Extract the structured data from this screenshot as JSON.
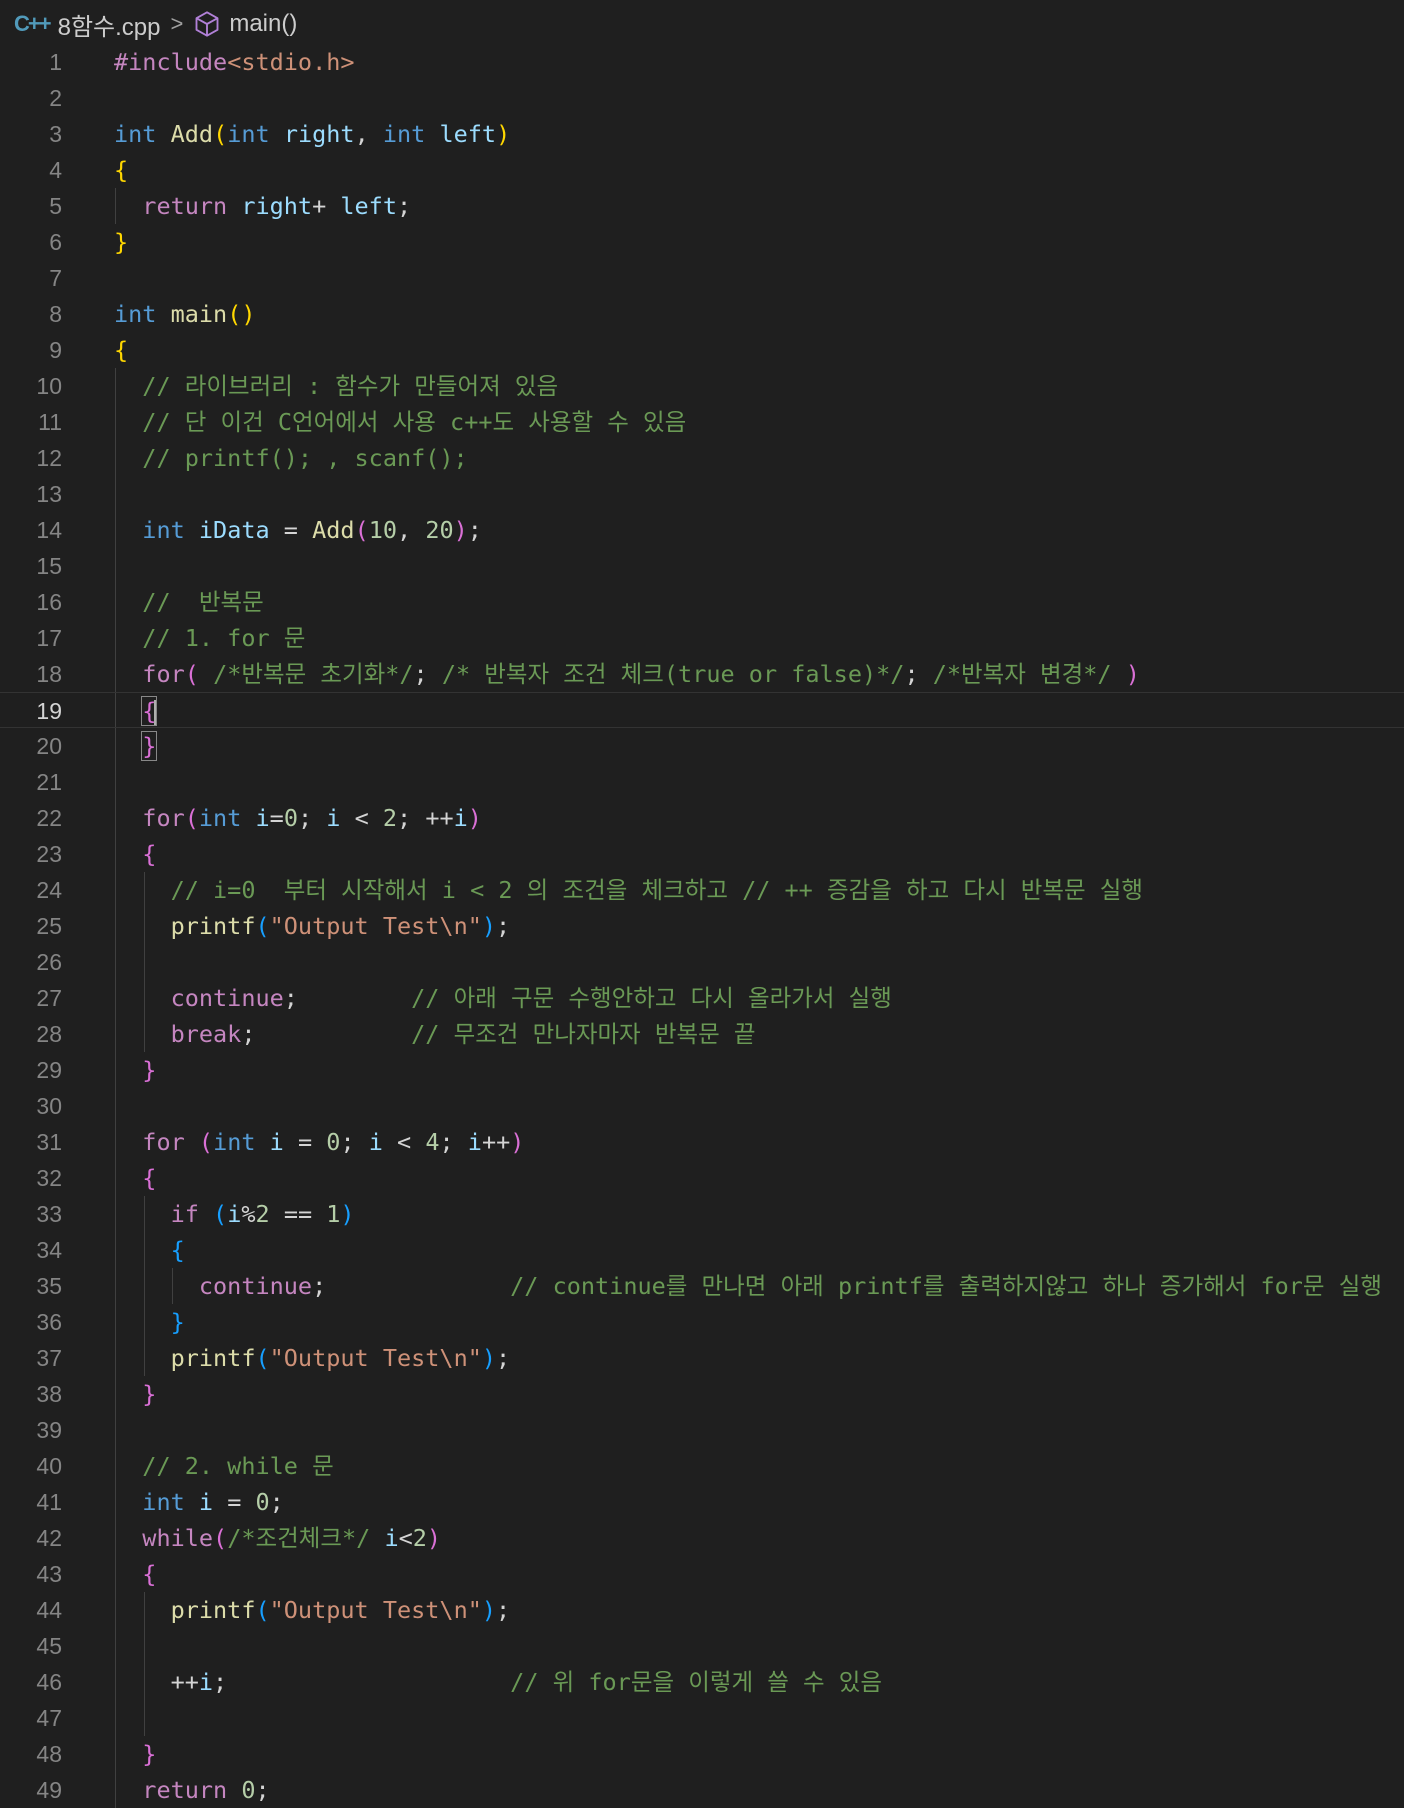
{
  "breadcrumb": {
    "file_icon": "C++",
    "file": "8함수.cpp",
    "symbol": "main()"
  },
  "active_line": 19,
  "lines": [
    {
      "n": "1",
      "t": [
        [
          "pp",
          "#include"
        ],
        [
          "inc",
          "<stdio.h>"
        ]
      ]
    },
    {
      "n": "2",
      "t": []
    },
    {
      "n": "3",
      "t": [
        [
          "kw",
          "int"
        ],
        [
          "txt",
          " "
        ],
        [
          "fn",
          "Add"
        ],
        [
          "b1",
          "("
        ],
        [
          "kw",
          "int"
        ],
        [
          "txt",
          " "
        ],
        [
          "var",
          "right"
        ],
        [
          "txt",
          ", "
        ],
        [
          "kw",
          "int"
        ],
        [
          "txt",
          " "
        ],
        [
          "var",
          "left"
        ],
        [
          "b1",
          ")"
        ]
      ]
    },
    {
      "n": "4",
      "t": [
        [
          "b1",
          "{"
        ]
      ]
    },
    {
      "n": "5",
      "t": [
        [
          "txt",
          "  "
        ],
        [
          "ctl",
          "return"
        ],
        [
          "txt",
          " "
        ],
        [
          "var",
          "right"
        ],
        [
          "txt",
          "+ "
        ],
        [
          "var",
          "left"
        ],
        [
          "txt",
          ";"
        ]
      ]
    },
    {
      "n": "6",
      "t": [
        [
          "b1",
          "}"
        ]
      ]
    },
    {
      "n": "7",
      "t": []
    },
    {
      "n": "8",
      "t": [
        [
          "kw",
          "int"
        ],
        [
          "txt",
          " "
        ],
        [
          "fn",
          "main"
        ],
        [
          "b1",
          "()"
        ]
      ]
    },
    {
      "n": "9",
      "t": [
        [
          "b1",
          "{"
        ]
      ]
    },
    {
      "n": "10",
      "t": [
        [
          "txt",
          "  "
        ],
        [
          "cmt",
          "// 라이브러리 : 함수가 만들어져 있음"
        ]
      ]
    },
    {
      "n": "11",
      "t": [
        [
          "txt",
          "  "
        ],
        [
          "cmt",
          "// 단 이건 C언어에서 사용 c++도 사용할 수 있음"
        ]
      ]
    },
    {
      "n": "12",
      "t": [
        [
          "txt",
          "  "
        ],
        [
          "cmt",
          "// printf(); , scanf();"
        ]
      ]
    },
    {
      "n": "13",
      "t": []
    },
    {
      "n": "14",
      "t": [
        [
          "txt",
          "  "
        ],
        [
          "kw",
          "int"
        ],
        [
          "txt",
          " "
        ],
        [
          "var",
          "iData"
        ],
        [
          "txt",
          " = "
        ],
        [
          "fn",
          "Add"
        ],
        [
          "b2",
          "("
        ],
        [
          "num",
          "10"
        ],
        [
          "txt",
          ", "
        ],
        [
          "num",
          "20"
        ],
        [
          "b2",
          ")"
        ],
        [
          "txt",
          ";"
        ]
      ]
    },
    {
      "n": "15",
      "t": []
    },
    {
      "n": "16",
      "t": [
        [
          "txt",
          "  "
        ],
        [
          "cmt",
          "//  반복문"
        ]
      ]
    },
    {
      "n": "17",
      "t": [
        [
          "txt",
          "  "
        ],
        [
          "cmt",
          "// 1. for 문"
        ]
      ]
    },
    {
      "n": "18",
      "t": [
        [
          "txt",
          "  "
        ],
        [
          "ctl",
          "for"
        ],
        [
          "b2",
          "("
        ],
        [
          "txt",
          " "
        ],
        [
          "cmt",
          "/*반복문 초기화*/"
        ],
        [
          "txt",
          "; "
        ],
        [
          "cmt",
          "/* 반복자 조건 체크(true or false)*/"
        ],
        [
          "txt",
          "; "
        ],
        [
          "cmt",
          "/*반복자 변경*/"
        ],
        [
          "txt",
          " "
        ],
        [
          "b2",
          ")"
        ]
      ]
    },
    {
      "n": "19",
      "t": [
        [
          "txt",
          "  "
        ],
        [
          "bx",
          "{"
        ]
      ]
    },
    {
      "n": "20",
      "t": [
        [
          "txt",
          "  "
        ],
        [
          "bx",
          "}"
        ]
      ]
    },
    {
      "n": "21",
      "t": []
    },
    {
      "n": "22",
      "t": [
        [
          "txt",
          "  "
        ],
        [
          "ctl",
          "for"
        ],
        [
          "b2",
          "("
        ],
        [
          "kw",
          "int"
        ],
        [
          "txt",
          " "
        ],
        [
          "var",
          "i"
        ],
        [
          "txt",
          "="
        ],
        [
          "num",
          "0"
        ],
        [
          "txt",
          "; "
        ],
        [
          "var",
          "i"
        ],
        [
          "txt",
          " < "
        ],
        [
          "num",
          "2"
        ],
        [
          "txt",
          "; ++"
        ],
        [
          "var",
          "i"
        ],
        [
          "b2",
          ")"
        ]
      ]
    },
    {
      "n": "23",
      "t": [
        [
          "txt",
          "  "
        ],
        [
          "b2",
          "{"
        ]
      ]
    },
    {
      "n": "24",
      "t": [
        [
          "txt",
          "    "
        ],
        [
          "cmt",
          "// i=0  부터 시작해서 i < 2 의 조건을 체크하고 // ++ 증감을 하고 다시 반복문 실행"
        ]
      ]
    },
    {
      "n": "25",
      "t": [
        [
          "txt",
          "    "
        ],
        [
          "fn",
          "printf"
        ],
        [
          "b3",
          "("
        ],
        [
          "str",
          "\"Output Test\\n\""
        ],
        [
          "b3",
          ")"
        ],
        [
          "txt",
          ";"
        ]
      ]
    },
    {
      "n": "26",
      "t": []
    },
    {
      "n": "27",
      "t": [
        [
          "txt",
          "    "
        ],
        [
          "ctl",
          "continue"
        ],
        [
          "txt",
          ";        "
        ],
        [
          "cmt",
          "// 아래 구문 수행안하고 다시 올라가서 실행"
        ]
      ]
    },
    {
      "n": "28",
      "t": [
        [
          "txt",
          "    "
        ],
        [
          "ctl",
          "break"
        ],
        [
          "txt",
          ";           "
        ],
        [
          "cmt",
          "// 무조건 만나자마자 반복문 끝"
        ]
      ]
    },
    {
      "n": "29",
      "t": [
        [
          "txt",
          "  "
        ],
        [
          "b2",
          "}"
        ]
      ]
    },
    {
      "n": "30",
      "t": []
    },
    {
      "n": "31",
      "t": [
        [
          "txt",
          "  "
        ],
        [
          "ctl",
          "for"
        ],
        [
          "txt",
          " "
        ],
        [
          "b2",
          "("
        ],
        [
          "kw",
          "int"
        ],
        [
          "txt",
          " "
        ],
        [
          "var",
          "i"
        ],
        [
          "txt",
          " = "
        ],
        [
          "num",
          "0"
        ],
        [
          "txt",
          "; "
        ],
        [
          "var",
          "i"
        ],
        [
          "txt",
          " < "
        ],
        [
          "num",
          "4"
        ],
        [
          "txt",
          "; "
        ],
        [
          "var",
          "i"
        ],
        [
          "txt",
          "++"
        ],
        [
          "b2",
          ")"
        ]
      ]
    },
    {
      "n": "32",
      "t": [
        [
          "txt",
          "  "
        ],
        [
          "b2",
          "{"
        ]
      ]
    },
    {
      "n": "33",
      "t": [
        [
          "txt",
          "    "
        ],
        [
          "ctl",
          "if"
        ],
        [
          "txt",
          " "
        ],
        [
          "b3",
          "("
        ],
        [
          "var",
          "i"
        ],
        [
          "txt",
          "%"
        ],
        [
          "num",
          "2"
        ],
        [
          "txt",
          " == "
        ],
        [
          "num",
          "1"
        ],
        [
          "b3",
          ")"
        ]
      ]
    },
    {
      "n": "34",
      "t": [
        [
          "txt",
          "    "
        ],
        [
          "b3",
          "{"
        ]
      ]
    },
    {
      "n": "35",
      "t": [
        [
          "txt",
          "      "
        ],
        [
          "ctl",
          "continue"
        ],
        [
          "txt",
          ";             "
        ],
        [
          "cmt",
          "// continue를 만나면 아래 printf를 출력하지않고 하나 증가해서 for문 실행"
        ]
      ]
    },
    {
      "n": "36",
      "t": [
        [
          "txt",
          "    "
        ],
        [
          "b3",
          "}"
        ]
      ]
    },
    {
      "n": "37",
      "t": [
        [
          "txt",
          "    "
        ],
        [
          "fn",
          "printf"
        ],
        [
          "b3",
          "("
        ],
        [
          "str",
          "\"Output Test\\n\""
        ],
        [
          "b3",
          ")"
        ],
        [
          "txt",
          ";"
        ]
      ]
    },
    {
      "n": "38",
      "t": [
        [
          "txt",
          "  "
        ],
        [
          "b2",
          "}"
        ]
      ]
    },
    {
      "n": "39",
      "t": []
    },
    {
      "n": "40",
      "t": [
        [
          "txt",
          "  "
        ],
        [
          "cmt",
          "// 2. while 문"
        ]
      ]
    },
    {
      "n": "41",
      "t": [
        [
          "txt",
          "  "
        ],
        [
          "kw",
          "int"
        ],
        [
          "txt",
          " "
        ],
        [
          "var",
          "i"
        ],
        [
          "txt",
          " = "
        ],
        [
          "num",
          "0"
        ],
        [
          "txt",
          ";"
        ]
      ]
    },
    {
      "n": "42",
      "t": [
        [
          "txt",
          "  "
        ],
        [
          "ctl",
          "while"
        ],
        [
          "b2",
          "("
        ],
        [
          "cmt",
          "/*조건체크*/"
        ],
        [
          "txt",
          " "
        ],
        [
          "var",
          "i"
        ],
        [
          "txt",
          "<"
        ],
        [
          "num",
          "2"
        ],
        [
          "b2",
          ")"
        ]
      ]
    },
    {
      "n": "43",
      "t": [
        [
          "txt",
          "  "
        ],
        [
          "b2",
          "{"
        ]
      ]
    },
    {
      "n": "44",
      "t": [
        [
          "txt",
          "    "
        ],
        [
          "fn",
          "printf"
        ],
        [
          "b3",
          "("
        ],
        [
          "str",
          "\"Output Test\\n\""
        ],
        [
          "b3",
          ")"
        ],
        [
          "txt",
          ";"
        ]
      ]
    },
    {
      "n": "45",
      "t": []
    },
    {
      "n": "46",
      "t": [
        [
          "txt",
          "    ++"
        ],
        [
          "var",
          "i"
        ],
        [
          "txt",
          ";                    "
        ],
        [
          "cmt",
          "// 위 for문을 이렇게 쓸 수 있음"
        ]
      ]
    },
    {
      "n": "47",
      "t": []
    },
    {
      "n": "48",
      "t": [
        [
          "txt",
          "  "
        ],
        [
          "b2",
          "}"
        ]
      ]
    },
    {
      "n": "49",
      "t": [
        [
          "txt",
          "  "
        ],
        [
          "ctl",
          "return"
        ],
        [
          "txt",
          " "
        ],
        [
          "num",
          "0"
        ],
        [
          "txt",
          ";"
        ]
      ]
    }
  ]
}
